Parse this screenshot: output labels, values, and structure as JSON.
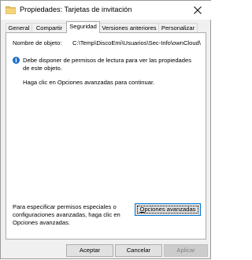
{
  "window": {
    "title": "Propiedades: Tarjetas de invitación"
  },
  "tabs": [
    {
      "label": "General"
    },
    {
      "label": "Compartir"
    },
    {
      "label": "Seguridad"
    },
    {
      "label": "Versiones anteriores"
    },
    {
      "label": "Personalizar"
    }
  ],
  "security": {
    "object_name_label": "Nombre de objeto:",
    "object_name_value": "C:\\Temp\\DiscoEmi\\Usuarios\\Sec-Info\\ownCloud\\",
    "info_line1": "Debe disponer de permisos de lectura para ver las propiedades",
    "info_line2": "de este objeto.",
    "advanced_hint": "Haga clic en Opciones avanzadas para continuar.",
    "special_text_line1": "Para especificar permisos especiales o",
    "special_text_line2": "configuraciones avanzadas, haga clic en",
    "special_text_line3": "Opciones avanzadas.",
    "advanced_button_first": "O",
    "advanced_button_rest": "pciones avanzadas"
  },
  "footer": {
    "accept_label": "Aceptar",
    "cancel_label": "Cancelar",
    "apply_label": "Aplicar"
  },
  "colors": {
    "accent": "#0078d7",
    "info_icon": "#1c6ecc"
  }
}
